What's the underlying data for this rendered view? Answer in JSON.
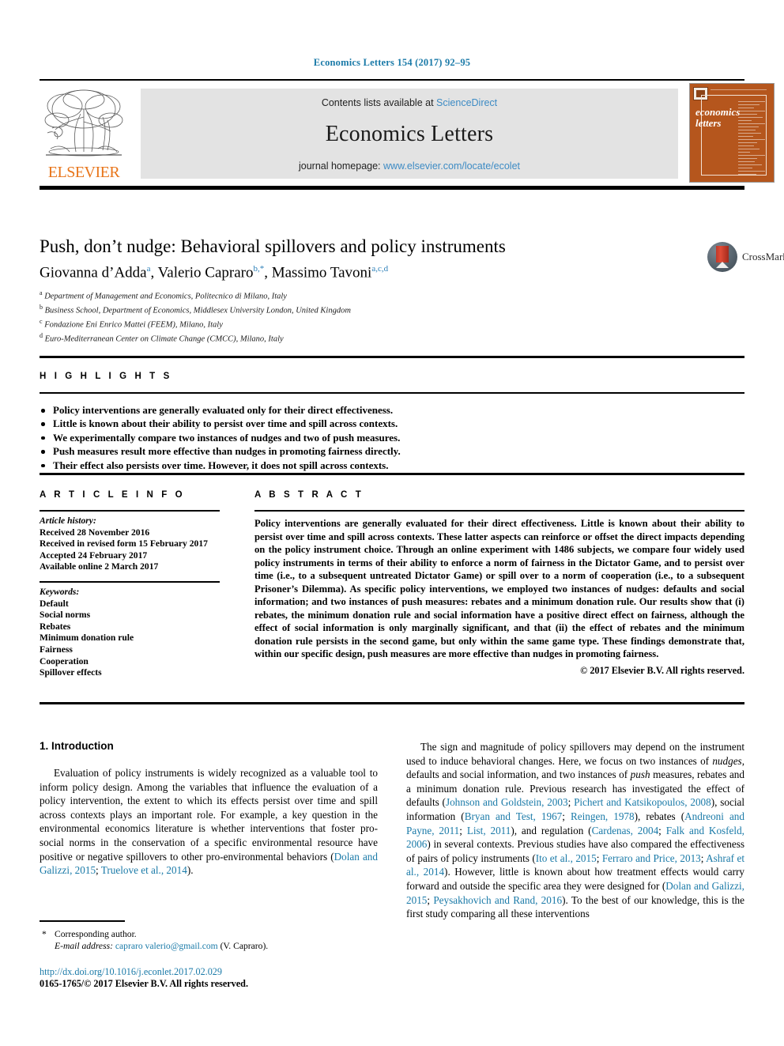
{
  "running_head": "Economics Letters 154 (2017) 92–95",
  "masthead": {
    "contents_line": "Contents lists available at",
    "sciencedirect": "ScienceDirect",
    "journal_title": "Economics Letters",
    "homepage_label": "journal homepage:",
    "homepage_url": "www.elsevier.com/locate/ecolet",
    "publisher_logo_text": "ELSEVIER",
    "cover_title_line1": "economics",
    "cover_title_line2": "letters"
  },
  "article": {
    "title": "Push, don’t nudge: Behavioral spillovers and policy instruments",
    "crossmark_label": "CrossMark",
    "authors": [
      {
        "name": "Giovanna d’Adda",
        "marks": "a"
      },
      {
        "name": "Valerio Capraro",
        "marks": "b,*"
      },
      {
        "name": "Massimo Tavoni",
        "marks": "a,c,d"
      }
    ],
    "affiliations": [
      {
        "mark": "a",
        "text": "Department of Management and Economics, Politecnico di Milano, Italy"
      },
      {
        "mark": "b",
        "text": "Business School, Department of Economics, Middlesex University London, United Kingdom"
      },
      {
        "mark": "c",
        "text": "Fondazione Eni Enrico Mattei (FEEM), Milano, Italy"
      },
      {
        "mark": "d",
        "text": "Euro-Mediterranean Center on Climate Change (CMCC), Milano, Italy"
      }
    ]
  },
  "highlights": {
    "heading": "H I G H L I G H T S",
    "items": [
      "Policy interventions are generally evaluated only for their direct effectiveness.",
      "Little is known about their ability to persist over time and spill across contexts.",
      "We experimentally compare two instances of nudges and two of push measures.",
      "Push measures result more effective than nudges in promoting fairness directly.",
      "Their effect also persists over time. However, it does not spill across contexts."
    ]
  },
  "article_info": {
    "heading": "A R T I C L E    I N F O",
    "history_label": "Article history:",
    "history": [
      "Received 28 November 2016",
      "Received in revised form 15 February 2017",
      "Accepted 24 February 2017",
      "Available online 2 March 2017"
    ],
    "keywords_label": "Keywords:",
    "keywords": [
      "Default",
      "Social norms",
      "Rebates",
      "Minimum donation rule",
      "Fairness",
      "Cooperation",
      "Spillover effects"
    ]
  },
  "abstract": {
    "heading": "A B S T R A C T",
    "text": "Policy interventions are generally evaluated for their direct effectiveness. Little is known about their ability to persist over time and spill across contexts. These latter aspects can reinforce or offset the direct impacts depending on the policy instrument choice. Through an online experiment with 1486 subjects, we compare four widely used policy instruments in terms of their ability to enforce a norm of fairness in the Dictator Game, and to persist over time (i.e., to a subsequent untreated Dictator Game) or spill over to a norm of cooperation (i.e., to a subsequent Prisoner’s Dilemma). As specific policy interventions, we employed two instances of nudges: defaults and social information; and two instances of push measures: rebates and a minimum donation rule. Our results show that (i) rebates, the minimum donation rule and social information have a positive direct effect on fairness, although the effect of social information is only marginally significant, and that (ii) the effect of rebates and the minimum donation rule persists in the second game, but only within the same game type. These findings demonstrate that, within our specific design, push measures are more effective than nudges in promoting fairness.",
    "copyright": "© 2017 Elsevier B.V. All rights reserved."
  },
  "body": {
    "section_title": "1. Introduction",
    "left_paragraph": "Evaluation of policy instruments is widely recognized as a valuable tool  to inform policy design. Among the variables that influence the evaluation of a policy intervention, the extent to which its effects persist over time and spill across contexts plays an important role. For example, a key question in the  environmental economics literature is whether interventions that foster pro-social norms in the conservation of a specific environmental resource have positive or negative spillovers to other pro-environmental behaviors (",
    "left_ref_1": "Dolan and Galizzi, 2015",
    "left_ref_2": "Truelove et al., 2014",
    "right_paragraph_1": "The sign and magnitude of policy spillovers may depend on the instrument used to induce behavioral changes. Here, we focus on two instances of ",
    "right_nudges": "nudges",
    "right_paragraph_2": ", defaults and social information, and two instances of ",
    "right_push": "push",
    "right_paragraph_3": " measures, rebates and a minimum donation rule. Previous research has investigated the effect of defaults (",
    "right_refs": [
      "Johnson and Goldstein, 2003",
      "Pichert and Katsikopoulos, 2008",
      "Bryan and Test, 1967",
      "Reingen, 1978",
      "Andreoni and Payne, 2011",
      "List, 2011",
      "Cardenas, 2004",
      "Falk and Kosfeld, 2006",
      "Ito et al., 2015",
      "Ferraro and Price, 2013",
      "Ashraf et al., 2014",
      "Dolan and Galizzi, 2015",
      "Peysakhovich and Rand, 2016"
    ],
    "right_t1": "), social information (",
    "right_t2": "), rebates (",
    "right_t3": "), and regulation  (",
    "right_t4": ") in several contexts. Previous studies have also compared the effectiveness of pairs of policy instruments (",
    "right_t5": "). However, little is known about how treatment effects would carry forward and outside the specific area they were designed for (",
    "right_t6": "). To the best of our knowledge, this is the first study comparing all these interventions"
  },
  "footnote": {
    "star": "*",
    "corresponding": "Corresponding author.",
    "email_label": "E-mail address:",
    "email": "capraro valerio@gmail.com",
    "email_display": "capraro valerio@gmail.com",
    "email_suffix": "(V. Capraro)."
  },
  "document_footer": {
    "doi": "http://dx.doi.org/10.1016/j.econlet.2017.02.029",
    "issn_line": "0165-1765/© 2017 Elsevier B.V. All rights reserved."
  },
  "colors": {
    "link_blue": "#1a7aa8",
    "sciencedirect_blue": "#3d8bc4",
    "elsevier_orange": "#e8751a",
    "cover_brown": "#b5561d"
  }
}
